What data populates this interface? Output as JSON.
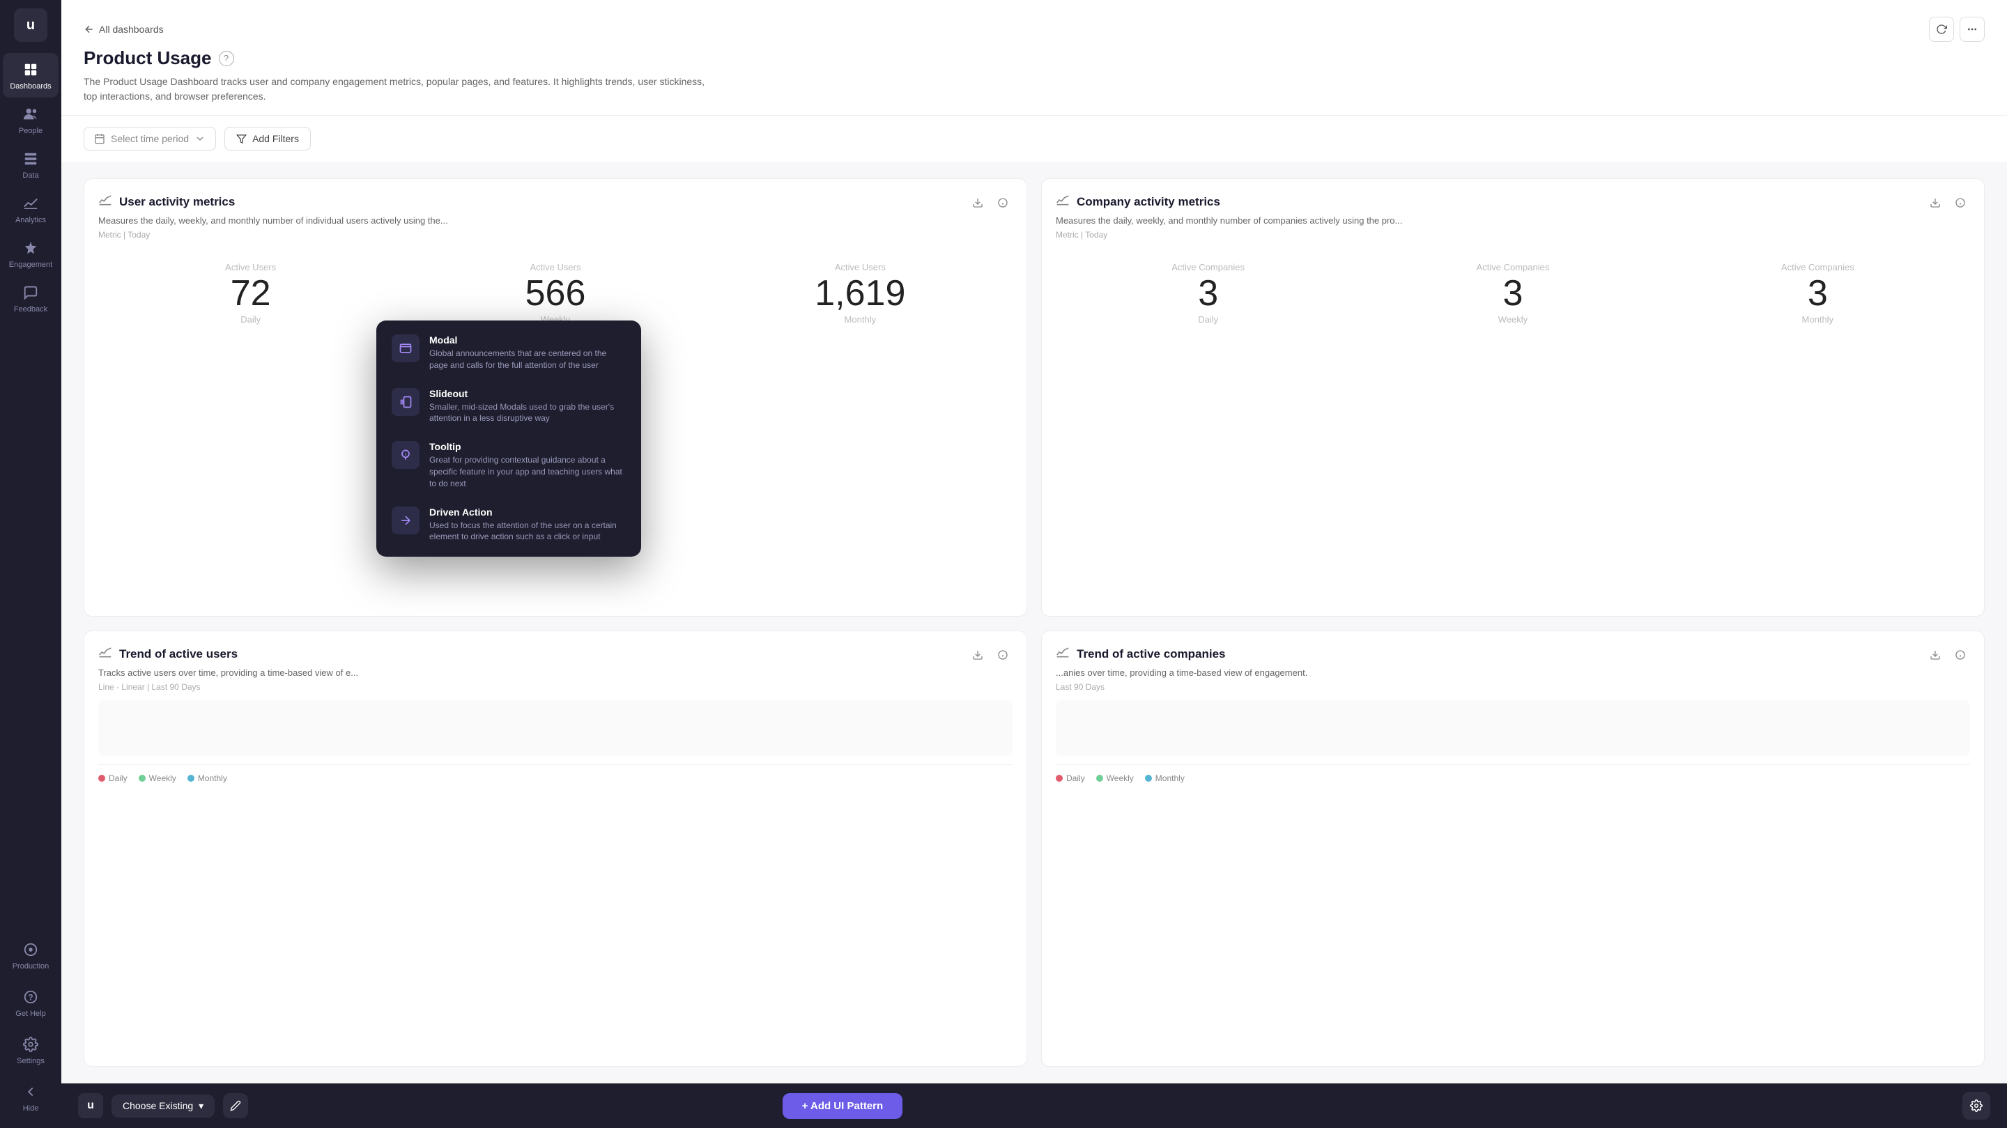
{
  "sidebar": {
    "logo": "u",
    "items": [
      {
        "id": "dashboards",
        "label": "Dashboards",
        "active": true
      },
      {
        "id": "people",
        "label": "People",
        "active": false
      },
      {
        "id": "data",
        "label": "Data",
        "active": false
      },
      {
        "id": "analytics",
        "label": "Analytics",
        "active": false
      },
      {
        "id": "engagement",
        "label": "Engagement",
        "active": false
      },
      {
        "id": "feedback",
        "label": "Feedback",
        "active": false
      }
    ],
    "bottom_items": [
      {
        "id": "production",
        "label": "Production"
      },
      {
        "id": "get-help",
        "label": "Get Help"
      },
      {
        "id": "settings",
        "label": "Settings"
      },
      {
        "id": "hide",
        "label": "Hide"
      }
    ]
  },
  "header": {
    "back_label": "All dashboards",
    "title": "Product Usage",
    "description": "The Product Usage Dashboard tracks user and company engagement metrics, popular pages, and features. It highlights trends, user stickiness, top interactions, and browser preferences.",
    "refresh_btn": "refresh",
    "more_btn": "more"
  },
  "filters": {
    "time_period_placeholder": "Select time period",
    "add_filters_label": "Add Filters"
  },
  "cards": {
    "user_activity": {
      "title": "User activity metrics",
      "description": "Measures the daily, weekly, and monthly number of individual users actively using the...",
      "meta": "Metric | Today",
      "metrics": [
        {
          "label": "Active Users",
          "value": "72",
          "period": "Daily"
        },
        {
          "label": "Active Users",
          "value": "566",
          "period": "Weekly"
        },
        {
          "label": "Active Users",
          "value": "1,619",
          "period": "Monthly"
        }
      ]
    },
    "company_activity": {
      "title": "Company activity metrics",
      "description": "Measures the daily, weekly, and monthly number of companies actively using the pro...",
      "meta": "Metric | Today",
      "metrics": [
        {
          "label": "Active Companies",
          "value": "3",
          "period": "Daily"
        },
        {
          "label": "Active Companies",
          "value": "3",
          "period": "Weekly"
        },
        {
          "label": "Active Companies",
          "value": "3",
          "period": "Monthly"
        }
      ]
    },
    "trend_users": {
      "title": "Trend of active users",
      "description": "Tracks active users over time, providing a time-based view of e...",
      "meta": "Line - Linear | Last 90 Days",
      "legend": [
        {
          "label": "Daily",
          "color": "#e05c6e"
        },
        {
          "label": "Weekly",
          "color": "#6fcf97"
        },
        {
          "label": "Monthly",
          "color": "#56b4d3"
        }
      ]
    },
    "trend_companies": {
      "title": "Trend of active companies",
      "description": "...anies over time, providing a time-based view of engagement.",
      "meta": "Last 90 Days",
      "legend": [
        {
          "label": "Daily",
          "color": "#e05c6e"
        },
        {
          "label": "Weekly",
          "color": "#6fcf97"
        },
        {
          "label": "Monthly",
          "color": "#56b4d3"
        }
      ]
    }
  },
  "dropdown": {
    "items": [
      {
        "id": "modal",
        "title": "Modal",
        "description": "Global announcements that are centered on the page and calls for the full attention of the user",
        "icon_color": "#6c5ce7"
      },
      {
        "id": "slideout",
        "title": "Slideout",
        "description": "Smaller, mid-sized Modals used to grab the user's attention in a less disruptive way",
        "icon_color": "#6c5ce7"
      },
      {
        "id": "tooltip",
        "title": "Tooltip",
        "description": "Great for providing contextual guidance about a specific feature in your app and teaching users what to do next",
        "icon_color": "#6c5ce7"
      },
      {
        "id": "driven-action",
        "title": "Driven Action",
        "description": "Used to focus the attention of the user on a certain element to drive action such as a click or input",
        "icon_color": "#6c5ce7"
      }
    ]
  },
  "bottom_bar": {
    "logo": "u",
    "choose_existing_label": "Choose Existing",
    "chevron_down": "▾",
    "add_pattern_label": "+ Add UI Pattern"
  }
}
